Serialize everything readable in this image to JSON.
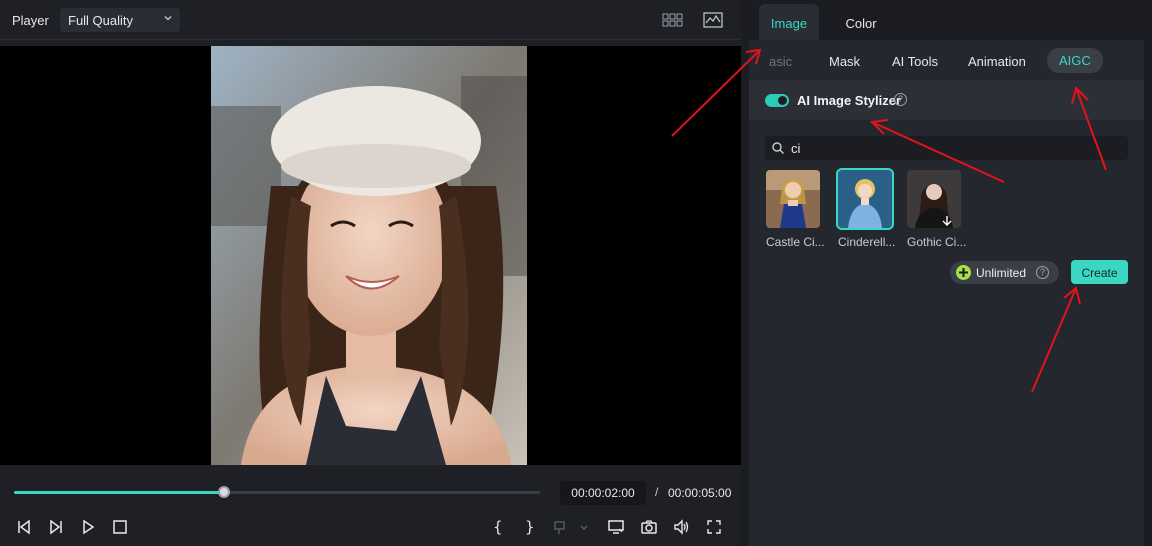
{
  "player": {
    "label": "Player",
    "quality": "Full Quality",
    "current_time": "00:00:02:00",
    "separator": "/",
    "total_time": "00:00:05:00",
    "progress": 0.4
  },
  "side": {
    "tabs": [
      {
        "label": "Image",
        "active": true
      },
      {
        "label": "Color",
        "active": false
      }
    ],
    "subtabs": [
      {
        "label": "asic"
      },
      {
        "label": "Mask"
      },
      {
        "label": "AI Tools"
      },
      {
        "label": "Animation"
      },
      {
        "label": "AIGC"
      }
    ],
    "stylizer": {
      "label": "AI Image Stylizer",
      "enabled": true,
      "help": "?"
    },
    "search": {
      "value": "ci",
      "placeholder": ""
    },
    "styles": [
      {
        "caption": "Castle Ci...",
        "selected": false
      },
      {
        "caption": "Cinderell...",
        "selected": true
      },
      {
        "caption": "Gothic Ci...",
        "selected": false
      }
    ],
    "unlimited_label": "Unlimited",
    "unlimited_help": "?",
    "create_label": "Create"
  },
  "colors": {
    "accent": "#3ad8c2",
    "annotation_arrow": "#e0141e"
  }
}
